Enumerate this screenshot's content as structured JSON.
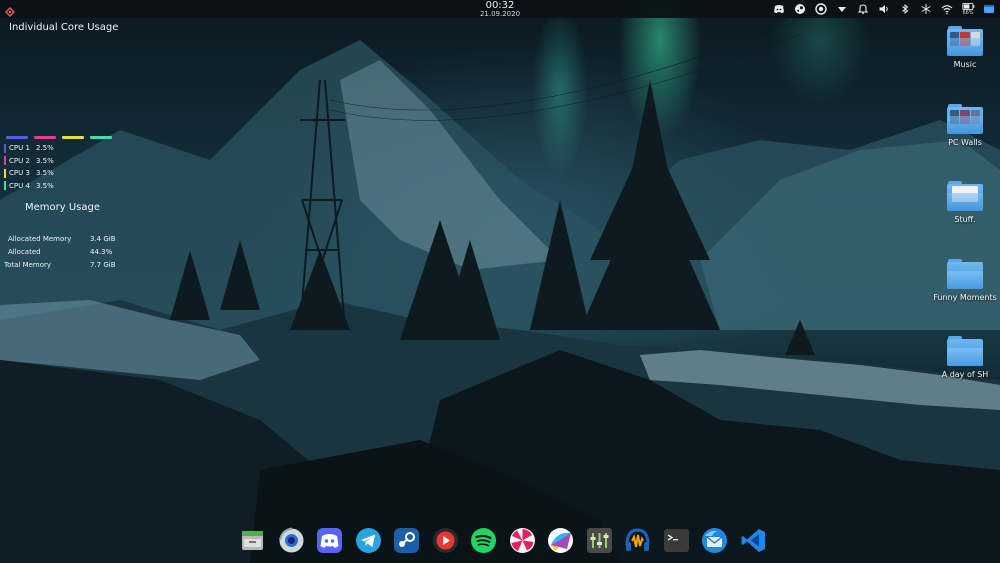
{
  "topbar": {
    "time": "00:32",
    "date": "21.09.2020",
    "battery_label": "66%",
    "tray_icons": [
      "discord-tray-icon",
      "steam-tray-icon",
      "record-tray-icon",
      "dropdown-icon",
      "bell-icon",
      "volume-icon",
      "bluetooth-icon",
      "snowflake-icon",
      "wifi-icon",
      "battery-icon",
      "window-icon"
    ]
  },
  "cpu_widget": {
    "title": "Individual Core Usage",
    "cores": [
      {
        "name": "CPU 1",
        "value": "2.5%",
        "color": "#5a5ae0"
      },
      {
        "name": "CPU 2",
        "value": "3.5%",
        "color": "#e0428a"
      },
      {
        "name": "CPU 3",
        "value": "3.5%",
        "color": "#e8e040"
      },
      {
        "name": "CPU 4",
        "value": "3.5%",
        "color": "#3ee0a8"
      }
    ]
  },
  "memory_widget": {
    "title": "Memory Usage",
    "rows": [
      {
        "label": "Allocated Memory",
        "value": "3.4 GiB"
      },
      {
        "label": "Allocated",
        "value": "44.3%"
      },
      {
        "label": "Total Memory",
        "value": "7.7 GiB"
      }
    ]
  },
  "desktop_icons": [
    {
      "label": "Music",
      "type": "thumbs"
    },
    {
      "label": "PC Walls",
      "type": "thumbs"
    },
    {
      "label": "Stuff.",
      "type": "paper"
    },
    {
      "label": "Funny Moments",
      "type": "plain"
    },
    {
      "label": "A day of SH",
      "type": "plain"
    }
  ],
  "dock": [
    "file-manager-icon",
    "chromium-icon",
    "discord-icon",
    "telegram-icon",
    "steam-icon",
    "youtube-music-icon",
    "spotify-icon",
    "lollypop-icon",
    "krita-icon",
    "mixer-icon",
    "audacity-icon",
    "terminal-icon",
    "thunderbird-icon",
    "vscode-icon"
  ],
  "colors": {
    "accent": "#5aa6e8",
    "topbar_bg": "#0a1016"
  }
}
